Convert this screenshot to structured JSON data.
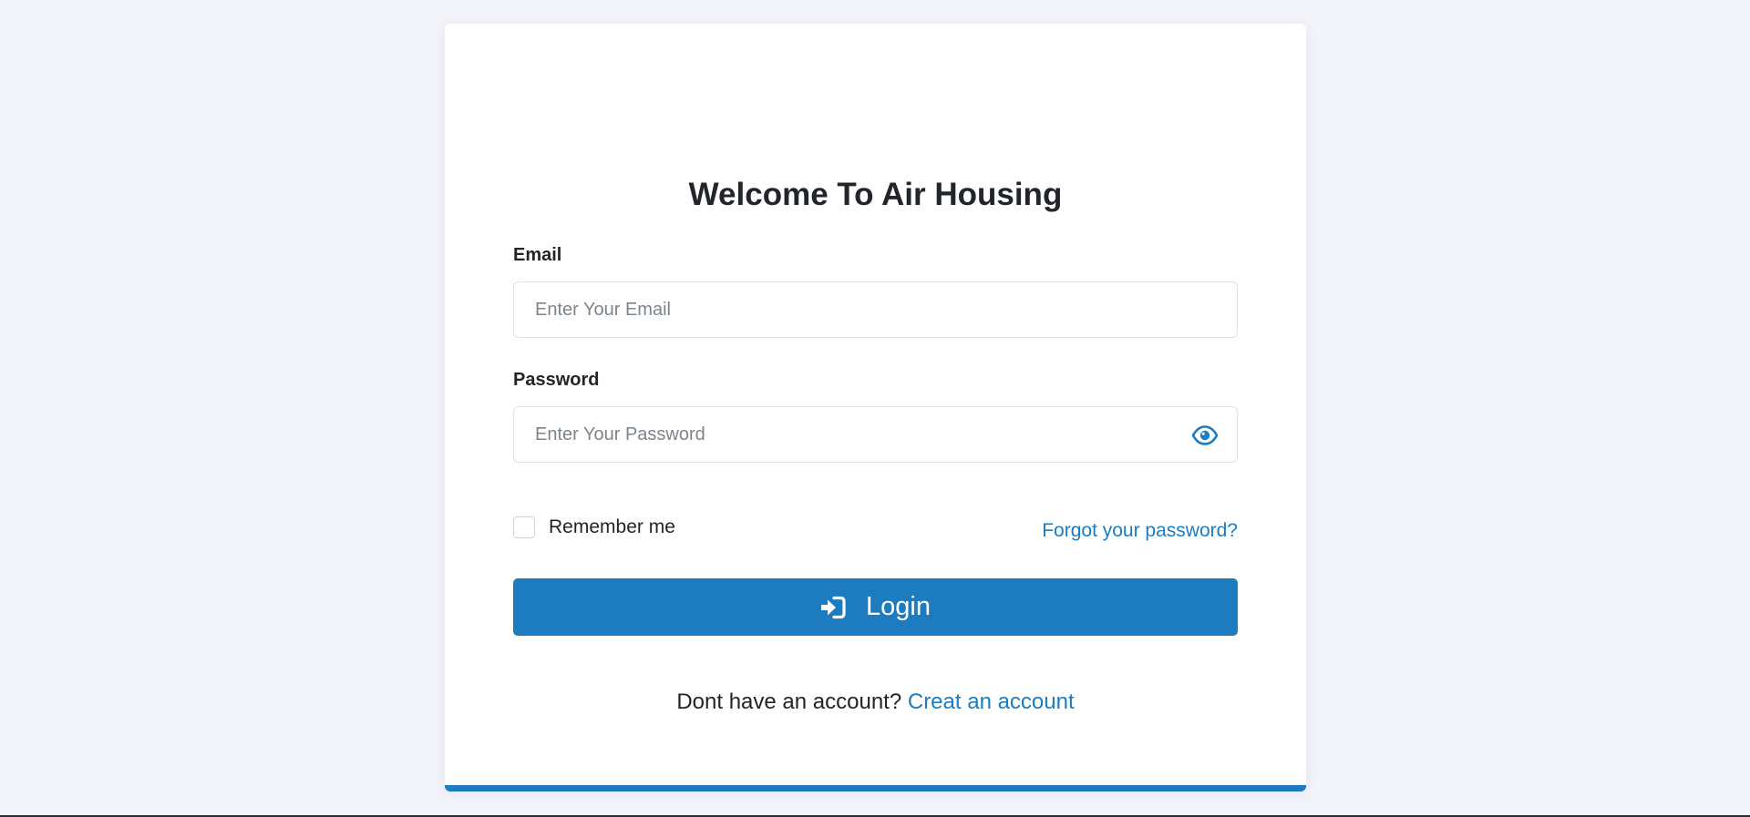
{
  "login": {
    "title": "Welcome To Air Housing",
    "email": {
      "label": "Email",
      "placeholder": "Enter Your Email",
      "value": ""
    },
    "password": {
      "label": "Password",
      "placeholder": "Enter Your Password",
      "value": "",
      "toggle_icon": "eye-icon"
    },
    "remember_me": {
      "label": "Remember me",
      "checked": false
    },
    "forgot_password_link": "Forgot your password?",
    "submit": {
      "label": "Login",
      "icon": "sign-in-icon"
    },
    "signup": {
      "prompt": "Dont have an account?",
      "link": "Creat an account"
    }
  },
  "colors": {
    "accent": "#1c7cbf",
    "background": "#f2f4f9",
    "card": "#ffffff",
    "text": "#212529"
  }
}
